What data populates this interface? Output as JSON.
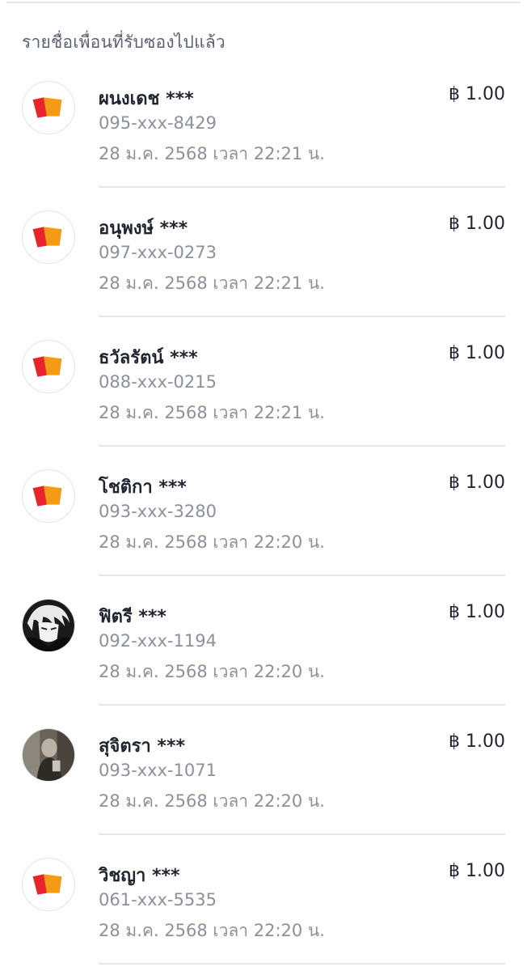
{
  "section_title": "รายชื่อเพื่อนที่รับซองไปแล้ว",
  "recipients": [
    {
      "name": "ผนงเดช ***",
      "phone": "095-xxx-8429",
      "datetime": "28 ม.ค. 2568 เวลา 22:21 น.",
      "amount": "฿ 1.00",
      "avatar": "brand-logo-icon"
    },
    {
      "name": "อนุพงษ์ ***",
      "phone": "097-xxx-0273",
      "datetime": "28 ม.ค. 2568 เวลา 22:21 น.",
      "amount": "฿ 1.00",
      "avatar": "brand-logo-icon"
    },
    {
      "name": "ธวัลรัตน์ ***",
      "phone": "088-xxx-0215",
      "datetime": "28 ม.ค. 2568 เวลา 22:21 น.",
      "amount": "฿ 1.00",
      "avatar": "brand-logo-icon"
    },
    {
      "name": "โชติกา ***",
      "phone": "093-xxx-3280",
      "datetime": "28 ม.ค. 2568 เวลา 22:20 น.",
      "amount": "฿ 1.00",
      "avatar": "brand-logo-icon"
    },
    {
      "name": "ฟิตรี ***",
      "phone": "092-xxx-1194",
      "datetime": "28 ม.ค. 2568 เวลา 22:20 น.",
      "amount": "฿ 1.00",
      "avatar": "anime-portrait-photo"
    },
    {
      "name": "สุจิตรา ***",
      "phone": "093-xxx-1071",
      "datetime": "28 ม.ค. 2568 เวลา 22:20 น.",
      "amount": "฿ 1.00",
      "avatar": "user-photo"
    },
    {
      "name": "วิชญา ***",
      "phone": "061-xxx-5535",
      "datetime": "28 ม.ค. 2568 เวลา 22:20 น.",
      "amount": "฿ 1.00",
      "avatar": "brand-logo-icon"
    }
  ],
  "colors": {
    "logo_red": "#e8242c",
    "logo_orange": "#f59a12",
    "text_primary": "#1f2430",
    "text_secondary": "#8b909b"
  }
}
